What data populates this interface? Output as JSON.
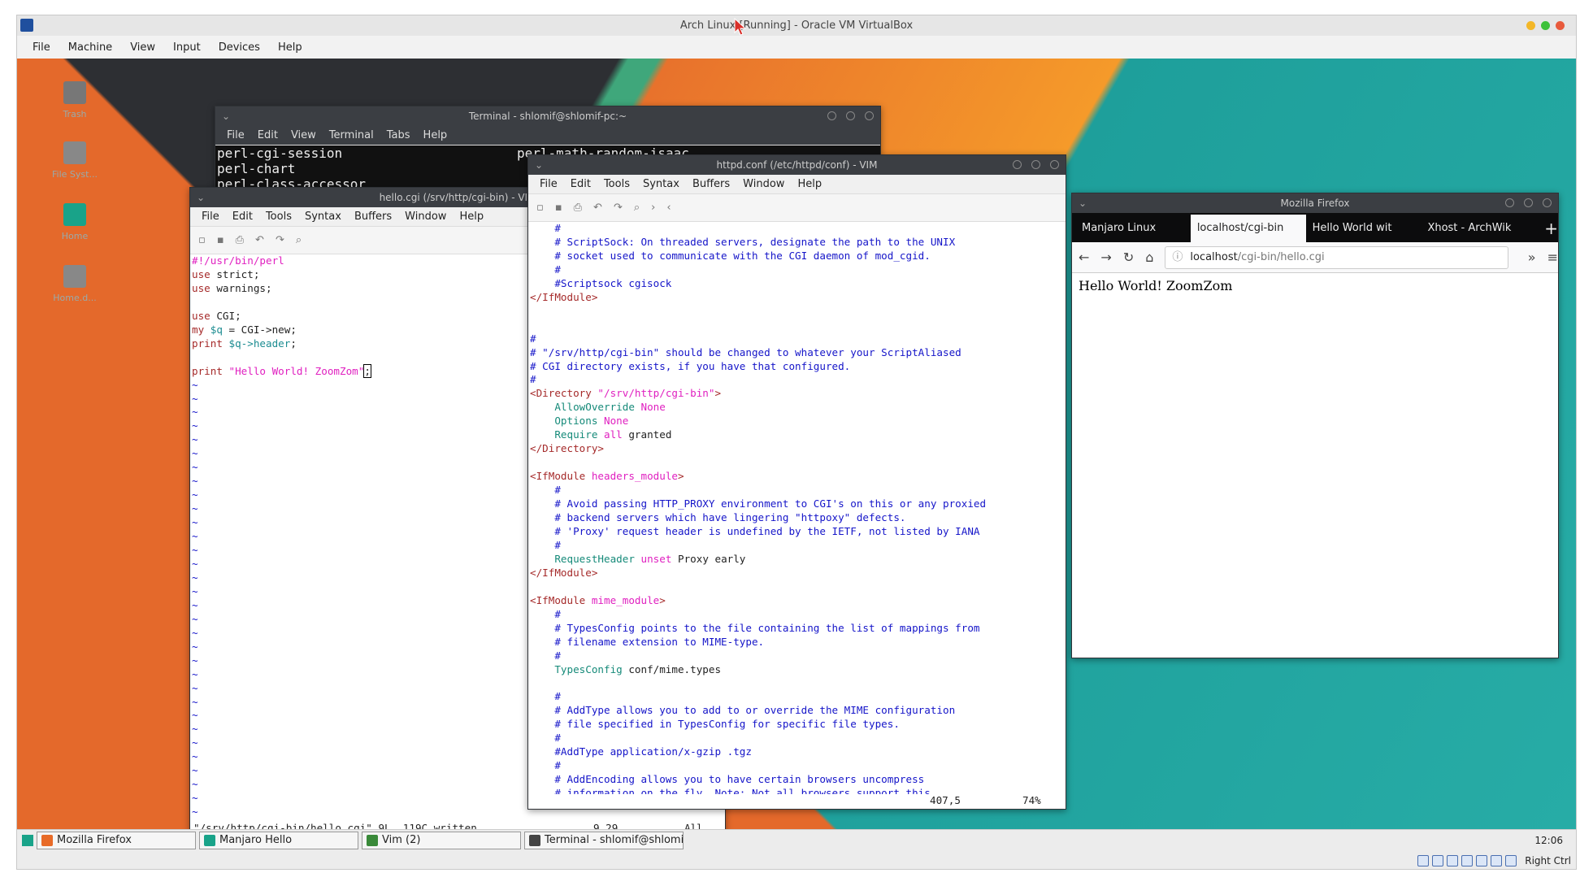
{
  "host": {
    "title": "Arch Linux [Running] - Oracle VM VirtualBox",
    "menu": [
      "File",
      "Machine",
      "View",
      "Input",
      "Devices",
      "Help"
    ],
    "hostkey": "Right Ctrl"
  },
  "desktop": {
    "icons": [
      "Trash",
      "File Syst...",
      "Home",
      "Home.d..."
    ]
  },
  "terminal": {
    "title": "Terminal - shlomif@shlomif-pc:~",
    "menu": [
      "File",
      "Edit",
      "View",
      "Terminal",
      "Tabs",
      "Help"
    ],
    "lines": [
      [
        "perl-cgi-session",
        "perl-math-random-isaac"
      ],
      [
        "perl-chart",
        ""
      ],
      [
        "perl-class-accessor",
        ""
      ]
    ]
  },
  "vim_hello": {
    "title": "hello.cgi (/srv/http/cgi-bin) - VIM",
    "menu": [
      "File",
      "Edit",
      "Tools",
      "Syntax",
      "Buffers",
      "Window",
      "Help"
    ],
    "shebang": "#!/usr/bin/perl",
    "l2a": "use",
    "l2b": " strict;",
    "l3a": "use",
    "l3b": " warnings;",
    "l5a": "use",
    "l5b": " CGI;",
    "l6a": "my",
    "l6b": " $q",
    "l6c": " = CGI->new;",
    "l7a": "print",
    "l7b": " $q->header",
    "l7c": ";",
    "l9a": "print",
    "l9b": " \"Hello World! ZoomZom\"",
    "l9c": ";",
    "status": "\"/srv/http/cgi-bin/hello.cgi\" 9L, 119C written",
    "pos": "9,29",
    "all": "All"
  },
  "vim_httpd": {
    "title": "httpd.conf (/etc/httpd/conf) - VIM",
    "menu": [
      "File",
      "Edit",
      "Tools",
      "Syntax",
      "Buffers",
      "Window",
      "Help"
    ],
    "c1": "    #",
    "c2": "    # ScriptSock: On threaded servers, designate the path to the UNIX",
    "c3": "    # socket used to communicate with the CGI daemon of mod_cgid.",
    "c4": "    #",
    "c5": "    #Scriptsock cgisock",
    "c6": "</IfModule>",
    "c9": "#",
    "c10": "# \"/srv/http/cgi-bin\" should be changed to whatever your ScriptAliased",
    "c11": "# CGI directory exists, if you have that configured.",
    "c12": "#",
    "c13a": "<Directory",
    "c13b": " \"/srv/http/cgi-bin\"",
    "c13c": ">",
    "c14a": "    AllowOverride",
    "c14b": " None",
    "c15a": "    Options",
    "c15b": " None",
    "c16a": "    Require",
    "c16b": " all",
    "c16c": " granted",
    "c17": "</Directory>",
    "c19a": "<IfModule",
    "c19b": " headers_module",
    "c19c": ">",
    "c20": "    #",
    "c21": "    # Avoid passing HTTP_PROXY environment to CGI's on this or any proxied",
    "c22": "    # backend servers which have lingering \"httpoxy\" defects.",
    "c23": "    # 'Proxy' request header is undefined by the IETF, not listed by IANA",
    "c24": "    #",
    "c25a": "    RequestHeader",
    "c25b": " unset",
    "c25c": " Proxy early",
    "c26": "</IfModule>",
    "c28a": "<IfModule",
    "c28b": " mime_module",
    "c28c": ">",
    "c29": "    #",
    "c30": "    # TypesConfig points to the file containing the list of mappings from",
    "c31": "    # filename extension to MIME-type.",
    "c32": "    #",
    "c33a": "    TypesConfig",
    "c33b": " conf/mime.types",
    "c35": "    #",
    "c36": "    # AddType allows you to add to or override the MIME configuration",
    "c37": "    # file specified in TypesConfig for specific file types.",
    "c38": "    #",
    "c39": "    #AddType application/x-gzip .tgz",
    "c40": "    #",
    "c41": "    # AddEncoding allows you to have certain browsers uncompress",
    "c42": "    # information on the fly. Note: Not all browsers support this.",
    "pos": "407,5",
    "pct": "74%"
  },
  "firefox": {
    "title": "Mozilla Firefox",
    "tabs": [
      "Manjaro Linux",
      "localhost/cgi-bin",
      "Hello World wit",
      "Xhost - ArchWik"
    ],
    "url": "localhost/cgi-bin/hello.cgi",
    "url_host": "localhost",
    "url_path": "/cgi-bin/hello.cgi",
    "content": "Hello World! ZoomZom"
  },
  "taskbar": {
    "items": [
      "Mozilla Firefox",
      "Manjaro Hello",
      "Vim (2)",
      "Terminal - shlomif@shlomi..."
    ],
    "clock": "12:06"
  }
}
